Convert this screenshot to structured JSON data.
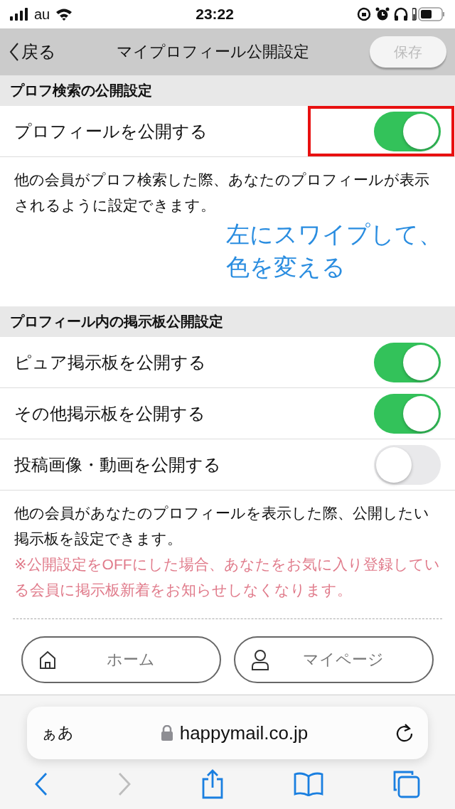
{
  "status_bar": {
    "carrier": "au",
    "time": "23:22"
  },
  "nav_bar": {
    "back": "戻る",
    "title": "マイプロフィール公開設定",
    "save": {
      "label": "保存",
      "disabled": true
    }
  },
  "sections": [
    {
      "title": "プロフ検索の公開設定",
      "rows": [
        {
          "label": "プロフィールを公開する",
          "on": true,
          "highlighted": true
        }
      ],
      "notes": [
        {
          "text": "他の会員がプロフ検索した際、あなたのプロフィールが表示されるように設定できます。",
          "kind": "normal"
        }
      ]
    },
    {
      "title": "プロフィール内の掲示板公開設定",
      "rows": [
        {
          "label": "ピュア掲示板を公開する",
          "on": true
        },
        {
          "label": "その他掲示板を公開する",
          "on": true
        },
        {
          "label": "投稿画像・動画を公開する",
          "on": false
        }
      ],
      "notes": [
        {
          "text": "他の会員があなたのプロフィールを表示した際、公開したい掲示板を設定できます。",
          "kind": "normal"
        },
        {
          "text": "※公開設定をOFFにした場合、あなたをお気に入り登録している会員に掲示板新着をお知らせしなくなります。",
          "kind": "warning"
        }
      ]
    }
  ],
  "annotation": {
    "lines": [
      "左にスワイプして、",
      "色を変える"
    ]
  },
  "bottom_buttons": [
    {
      "label": "ホーム",
      "kind": "home"
    },
    {
      "label": "マイページ",
      "kind": "person"
    }
  ],
  "browser": {
    "text_size": "ぁあ",
    "url": "happymail.co.jp",
    "forward_disabled": true
  }
}
